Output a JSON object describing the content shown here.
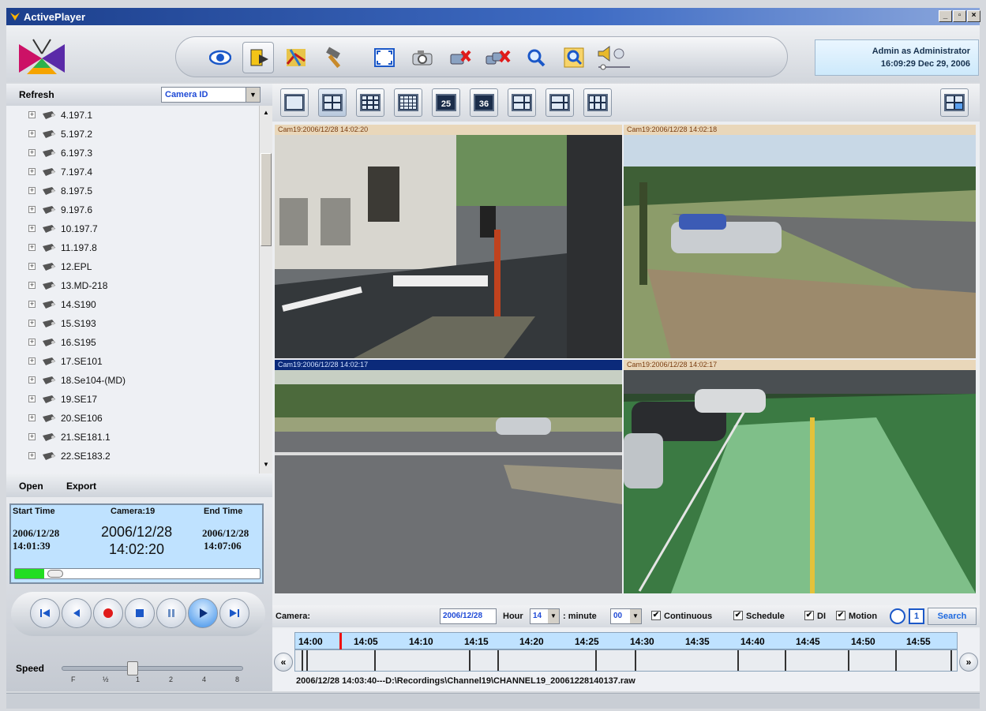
{
  "window": {
    "title": "ActivePlayer",
    "controls": [
      "_",
      "▫",
      "×"
    ]
  },
  "toolbar": {
    "tools": [
      {
        "name": "live-view",
        "icon": "eye-icon"
      },
      {
        "name": "playback",
        "icon": "playback-icon"
      },
      {
        "name": "map",
        "icon": "map-icon"
      },
      {
        "name": "setup",
        "icon": "hammer-icon"
      },
      {
        "name": "fullscreen",
        "icon": "fullscreen-icon"
      },
      {
        "name": "snapshot",
        "icon": "camera-icon"
      },
      {
        "name": "disconnect",
        "icon": "disconnect-icon"
      },
      {
        "name": "disconnect-all",
        "icon": "disconnect-all-icon"
      },
      {
        "name": "zoom",
        "icon": "magnifier-icon"
      },
      {
        "name": "digital-zoom",
        "icon": "zoom-frame-icon"
      },
      {
        "name": "volume",
        "icon": "speaker-icon"
      }
    ]
  },
  "user": {
    "line1": "Admin as Administrator",
    "line2": "16:09:29 Dec 29, 2006"
  },
  "tree": {
    "refresh_label": "Refresh",
    "filter_value": "Camera ID",
    "nodes": [
      "4.197.1",
      "5.197.2",
      "6.197.3",
      "7.197.4",
      "8.197.5",
      "9.197.6",
      "10.197.7",
      "11.197.8",
      "12.EPL",
      "13.MD-218",
      "14.S190",
      "15.S193",
      "16.S195",
      "17.SE101",
      "18.Se104-(MD)",
      "19.SE17",
      "20.SE106",
      "21.SE181.1",
      "22.SE183.2"
    ]
  },
  "file_menu": {
    "open": "Open",
    "export": "Export"
  },
  "playback_info": {
    "start_label": "Start Time",
    "camera_label": "Camera:19",
    "end_label": "End Time",
    "start_date": "2006/12/28",
    "start_time": "14:01:39",
    "current_date": "2006/12/28",
    "current_time": "14:02:20",
    "end_date": "2006/12/28",
    "end_time": "14:07:06",
    "progress": 0.12
  },
  "player_buttons": [
    "skip-back-icon",
    "rewind-icon",
    "record-icon",
    "stop-icon",
    "pause-icon",
    "play-icon",
    "skip-forward-icon"
  ],
  "speed": {
    "label": "Speed",
    "ticks": [
      "F",
      "½",
      "1",
      "2",
      "4",
      "8"
    ],
    "value": "1"
  },
  "layouts": [
    "1",
    "4",
    "9",
    "16",
    "25",
    "36",
    "1+5",
    "1+7",
    "1+12"
  ],
  "layout_numbers": {
    "25": "25",
    "36": "36"
  },
  "video": [
    {
      "label": "Cam19:2006/12/28 14:02:20",
      "selected": false
    },
    {
      "label": "Cam19:2006/12/28 14:02:18",
      "selected": false
    },
    {
      "label": "Cam19:2006/12/28 14:02:17",
      "selected": true
    },
    {
      "label": "Cam19:2006/12/28 14:02:17",
      "selected": false
    }
  ],
  "search": {
    "camera_label": "Camera:",
    "date_value": "2006/12/28",
    "hour_label": "Hour",
    "hour_value": "14",
    "minute_label": ": minute",
    "minute_value": "00",
    "continuous_label": "Continuous",
    "schedule_label": "Schedule",
    "di_label": "DI",
    "motion_label": "Motion",
    "search_button": "Search",
    "one_label": "1"
  },
  "timeline": {
    "hours": [
      "14:00",
      "14:05",
      "14:10",
      "14:15",
      "14:20",
      "14:25",
      "14:30",
      "14:35",
      "14:40",
      "14:45",
      "14:50",
      "14:55"
    ],
    "path": "2006/12/28 14:03:40---D:\\Recordings\\Channel19\\CHANNEL19_20061228140137.raw",
    "nav_left": "«",
    "nav_right": "»"
  }
}
